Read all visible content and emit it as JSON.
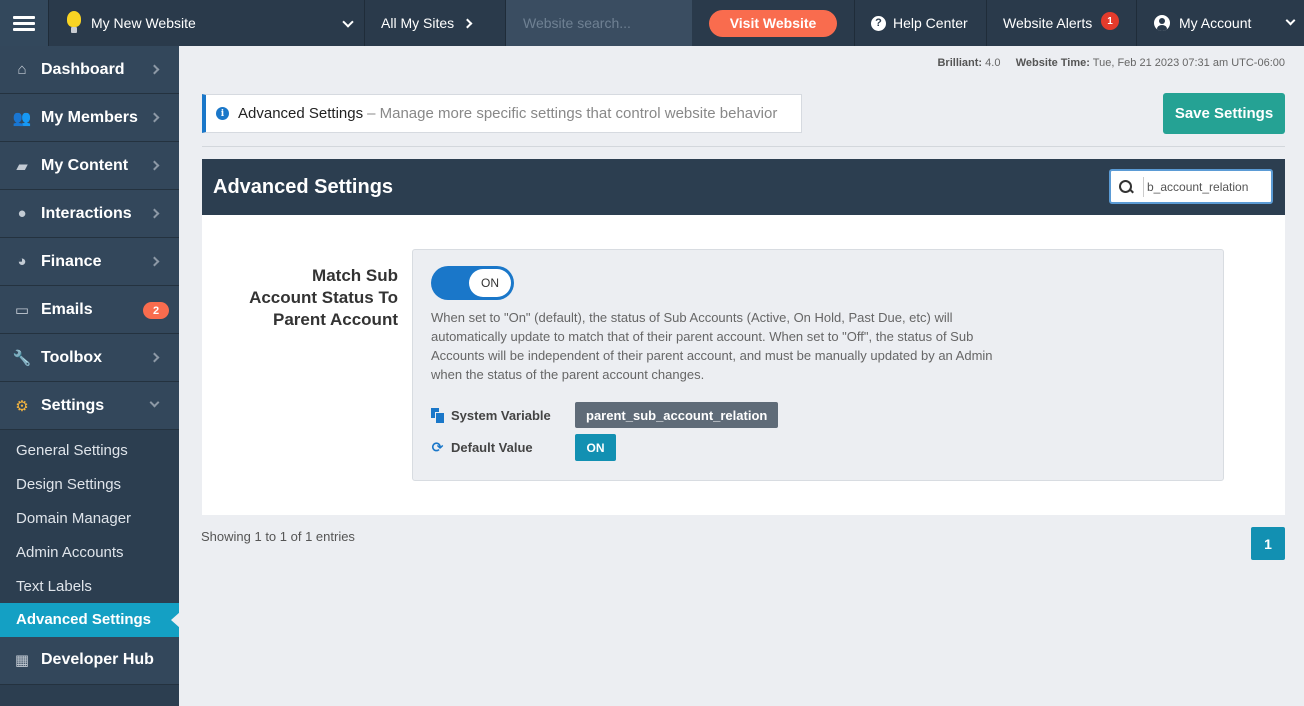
{
  "topbar": {
    "site_name": "My New Website",
    "all_sites": "All My Sites",
    "search_placeholder": "Website search...",
    "visit_label": "Visit Website",
    "help_label": "Help Center",
    "alerts_label": "Website Alerts",
    "alerts_count": "1",
    "account_label": "My Account"
  },
  "sidebar": {
    "items": [
      {
        "label": "Dashboard",
        "icon": "home-icon"
      },
      {
        "label": "My Members",
        "icon": "users-icon"
      },
      {
        "label": "My Content",
        "icon": "folder-icon"
      },
      {
        "label": "Interactions",
        "icon": "comments-icon"
      },
      {
        "label": "Finance",
        "icon": "pie-chart-icon"
      },
      {
        "label": "Emails",
        "icon": "inbox-icon",
        "badge": "2"
      },
      {
        "label": "Toolbox",
        "icon": "wrench-icon"
      },
      {
        "label": "Settings",
        "icon": "gear-icon"
      }
    ],
    "sub_items": [
      "General Settings",
      "Design Settings",
      "Domain Manager",
      "Admin Accounts",
      "Text Labels",
      "Advanced Settings"
    ],
    "developer_hub": "Developer Hub"
  },
  "meta": {
    "plan_label": "Brilliant:",
    "plan_value": "4.0",
    "time_label": "Website Time:",
    "time_value": "Tue, Feb 21 2023 07:31 am UTC-06:00"
  },
  "header": {
    "title": "Advanced Settings",
    "description": "– Manage more specific settings that control website behavior",
    "save_label": "Save Settings"
  },
  "panel": {
    "title": "Advanced Settings",
    "search_value": "b_account_relation"
  },
  "setting": {
    "label_line1": "Match Sub",
    "label_line2": "Account Status To",
    "label_line3": "Parent Account",
    "toggle_state": "ON",
    "help_text": "When set to \"On\" (default), the status of Sub Accounts (Active, On Hold, Past Due, etc) will automatically update to match that of their parent account. When set to \"Off\", the status of Sub Accounts will be independent of their parent account, and must be manually updated by an Admin when the status of the parent account changes.",
    "system_variable_label": "System Variable",
    "system_variable_value": "parent_sub_account_relation",
    "default_value_label": "Default Value",
    "default_value": "ON"
  },
  "footer": {
    "showing": "Showing 1 to 1 of 1 entries",
    "page": "1"
  },
  "colors": {
    "accent": "#1a77c9",
    "save": "#25a294",
    "visit": "#f96c4e",
    "active_nav": "#14a0c4"
  }
}
